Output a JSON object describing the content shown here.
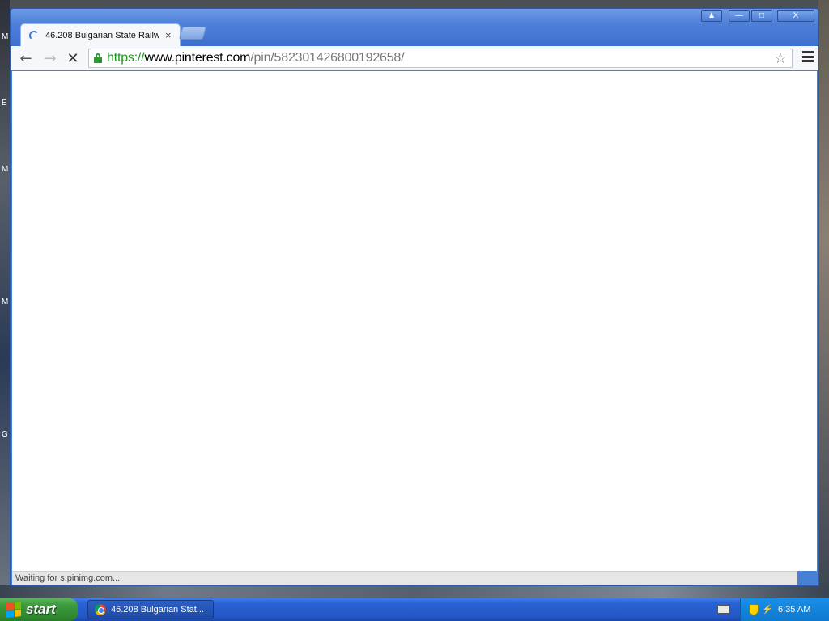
{
  "desktop": {
    "icon_letters": [
      "M",
      "E",
      "M",
      "M",
      "G"
    ]
  },
  "browser": {
    "tab": {
      "title": "46.208 Bulgarian State Railw",
      "close_glyph": "×"
    },
    "window_buttons": {
      "minimize": "—",
      "maximize": "□",
      "close": "X"
    },
    "toolbar": {
      "back_icon": "←",
      "forward_icon": "→",
      "stop_icon": "✕",
      "url_scheme": "https://",
      "url_host": "www.pinterest.com",
      "url_path": "/pin/582301426800192658/",
      "bookmark_icon": "☆"
    },
    "status_text": "Waiting for s.pinimg.com..."
  },
  "taskbar": {
    "start_label": "start",
    "task_item_label": "46.208 Bulgarian Stat...",
    "clock": "6:35 AM"
  }
}
